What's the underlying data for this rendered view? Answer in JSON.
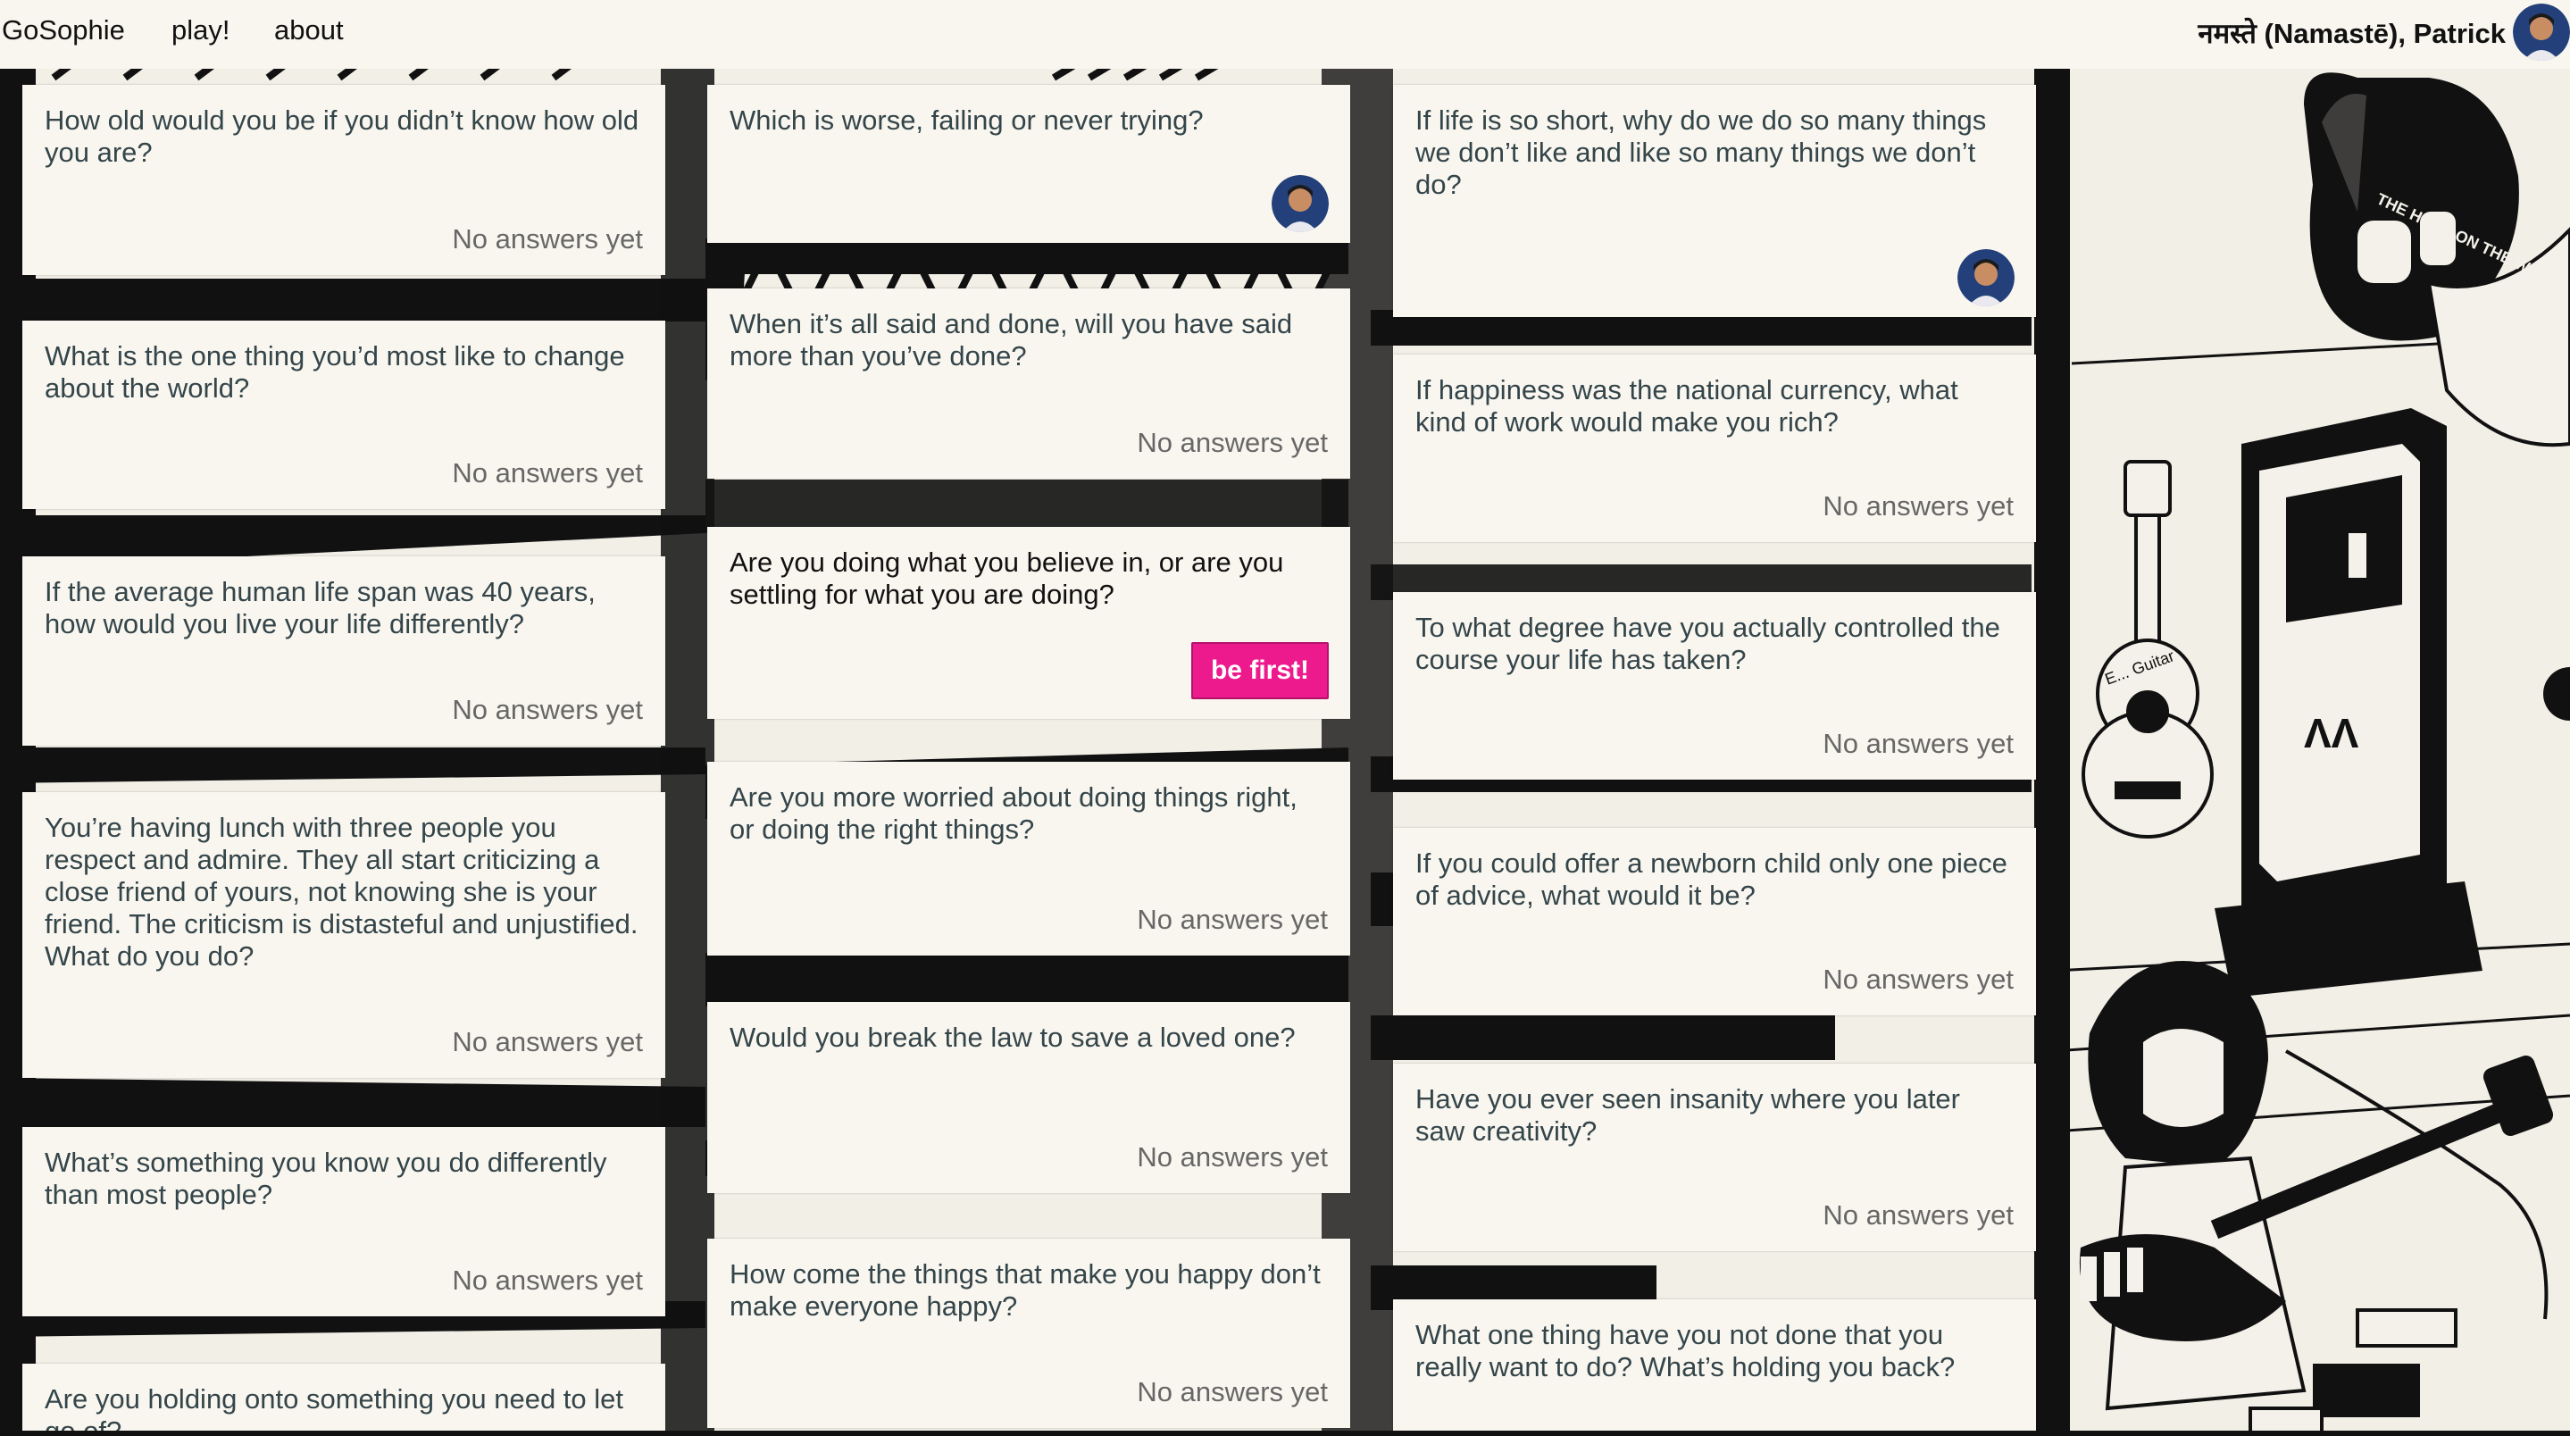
{
  "nav": {
    "brand": "GoSophie",
    "play": "play!",
    "about": "about",
    "greeting": "नमस्ते (Namastē), Patrick"
  },
  "colors": {
    "page_bg": "#f9f6ef",
    "card_text": "#34454a",
    "status_text": "#676767",
    "accent": "#ec1a8d"
  },
  "columns": [
    {
      "cards": [
        {
          "question": "How old would you be if you didn’t know how old you are?",
          "status": "No answers yet"
        },
        {
          "question": "What is the one thing you’d most like to change about the world?",
          "status": "No answers yet"
        },
        {
          "question": "If the average human life span was 40 years, how would you live your life differently?",
          "status": "No answers yet"
        },
        {
          "question": "You’re having lunch with three people you respect and admire. They all start criticizing a close friend of yours, not knowing she is your friend. The criticism is distasteful and unjustified. What do you do?",
          "status": "No answers yet"
        },
        {
          "question": "What’s something you know you do differently than most people?",
          "status": "No answers yet"
        },
        {
          "question": "Are you holding onto something you need to let go of?",
          "status": ""
        }
      ]
    },
    {
      "cards": [
        {
          "question": "Which is worse, failing or never trying?",
          "status": ""
        },
        {
          "question": "When it’s all said and done, will you have said more than you’ve done?",
          "status": "No answers yet"
        },
        {
          "question": "Are you doing what you believe in, or are you settling for what you are doing?",
          "status": "",
          "button": "be first!"
        },
        {
          "question": "Are you more worried about doing things right, or doing the right things?",
          "status": "No answers yet"
        },
        {
          "question": "Would you break the law to save a loved one?",
          "status": "No answers yet"
        },
        {
          "question": "How come the things that make you happy don’t make everyone happy?",
          "status": "No answers yet"
        }
      ]
    },
    {
      "cards": [
        {
          "question": "If life is so short, why do we do so many things we don’t like and like so many things we don’t do?",
          "status": ""
        },
        {
          "question": "If happiness was the national currency, what kind of work would make you rich?",
          "status": "No answers yet"
        },
        {
          "question": "To what degree have you actually controlled the course your life has taken?",
          "status": "No answers yet"
        },
        {
          "question": "If you could offer a newborn child only one piece of advice, what would it be?",
          "status": "No answers yet"
        },
        {
          "question": "Have you ever seen insanity where you later saw creativity?",
          "status": "No answers yet"
        },
        {
          "question": "What one thing have you not done that you really want to do? What’s holding you back?",
          "status": ""
        }
      ]
    }
  ],
  "background_art": {
    "ukulele_text": "E... Guitar",
    "amp_text": "THE HEAD ON THE WALL"
  }
}
